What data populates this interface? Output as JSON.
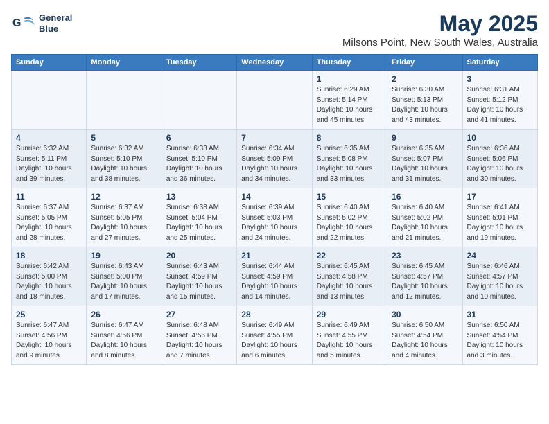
{
  "logo": {
    "line1": "General",
    "line2": "Blue"
  },
  "title": "May 2025",
  "subtitle": "Milsons Point, New South Wales, Australia",
  "days_of_week": [
    "Sunday",
    "Monday",
    "Tuesday",
    "Wednesday",
    "Thursday",
    "Friday",
    "Saturday"
  ],
  "weeks": [
    [
      {
        "num": "",
        "info": ""
      },
      {
        "num": "",
        "info": ""
      },
      {
        "num": "",
        "info": ""
      },
      {
        "num": "",
        "info": ""
      },
      {
        "num": "1",
        "info": "Sunrise: 6:29 AM\nSunset: 5:14 PM\nDaylight: 10 hours\nand 45 minutes."
      },
      {
        "num": "2",
        "info": "Sunrise: 6:30 AM\nSunset: 5:13 PM\nDaylight: 10 hours\nand 43 minutes."
      },
      {
        "num": "3",
        "info": "Sunrise: 6:31 AM\nSunset: 5:12 PM\nDaylight: 10 hours\nand 41 minutes."
      }
    ],
    [
      {
        "num": "4",
        "info": "Sunrise: 6:32 AM\nSunset: 5:11 PM\nDaylight: 10 hours\nand 39 minutes."
      },
      {
        "num": "5",
        "info": "Sunrise: 6:32 AM\nSunset: 5:10 PM\nDaylight: 10 hours\nand 38 minutes."
      },
      {
        "num": "6",
        "info": "Sunrise: 6:33 AM\nSunset: 5:10 PM\nDaylight: 10 hours\nand 36 minutes."
      },
      {
        "num": "7",
        "info": "Sunrise: 6:34 AM\nSunset: 5:09 PM\nDaylight: 10 hours\nand 34 minutes."
      },
      {
        "num": "8",
        "info": "Sunrise: 6:35 AM\nSunset: 5:08 PM\nDaylight: 10 hours\nand 33 minutes."
      },
      {
        "num": "9",
        "info": "Sunrise: 6:35 AM\nSunset: 5:07 PM\nDaylight: 10 hours\nand 31 minutes."
      },
      {
        "num": "10",
        "info": "Sunrise: 6:36 AM\nSunset: 5:06 PM\nDaylight: 10 hours\nand 30 minutes."
      }
    ],
    [
      {
        "num": "11",
        "info": "Sunrise: 6:37 AM\nSunset: 5:05 PM\nDaylight: 10 hours\nand 28 minutes."
      },
      {
        "num": "12",
        "info": "Sunrise: 6:37 AM\nSunset: 5:05 PM\nDaylight: 10 hours\nand 27 minutes."
      },
      {
        "num": "13",
        "info": "Sunrise: 6:38 AM\nSunset: 5:04 PM\nDaylight: 10 hours\nand 25 minutes."
      },
      {
        "num": "14",
        "info": "Sunrise: 6:39 AM\nSunset: 5:03 PM\nDaylight: 10 hours\nand 24 minutes."
      },
      {
        "num": "15",
        "info": "Sunrise: 6:40 AM\nSunset: 5:02 PM\nDaylight: 10 hours\nand 22 minutes."
      },
      {
        "num": "16",
        "info": "Sunrise: 6:40 AM\nSunset: 5:02 PM\nDaylight: 10 hours\nand 21 minutes."
      },
      {
        "num": "17",
        "info": "Sunrise: 6:41 AM\nSunset: 5:01 PM\nDaylight: 10 hours\nand 19 minutes."
      }
    ],
    [
      {
        "num": "18",
        "info": "Sunrise: 6:42 AM\nSunset: 5:00 PM\nDaylight: 10 hours\nand 18 minutes."
      },
      {
        "num": "19",
        "info": "Sunrise: 6:43 AM\nSunset: 5:00 PM\nDaylight: 10 hours\nand 17 minutes."
      },
      {
        "num": "20",
        "info": "Sunrise: 6:43 AM\nSunset: 4:59 PM\nDaylight: 10 hours\nand 15 minutes."
      },
      {
        "num": "21",
        "info": "Sunrise: 6:44 AM\nSunset: 4:59 PM\nDaylight: 10 hours\nand 14 minutes."
      },
      {
        "num": "22",
        "info": "Sunrise: 6:45 AM\nSunset: 4:58 PM\nDaylight: 10 hours\nand 13 minutes."
      },
      {
        "num": "23",
        "info": "Sunrise: 6:45 AM\nSunset: 4:57 PM\nDaylight: 10 hours\nand 12 minutes."
      },
      {
        "num": "24",
        "info": "Sunrise: 6:46 AM\nSunset: 4:57 PM\nDaylight: 10 hours\nand 10 minutes."
      }
    ],
    [
      {
        "num": "25",
        "info": "Sunrise: 6:47 AM\nSunset: 4:56 PM\nDaylight: 10 hours\nand 9 minutes."
      },
      {
        "num": "26",
        "info": "Sunrise: 6:47 AM\nSunset: 4:56 PM\nDaylight: 10 hours\nand 8 minutes."
      },
      {
        "num": "27",
        "info": "Sunrise: 6:48 AM\nSunset: 4:56 PM\nDaylight: 10 hours\nand 7 minutes."
      },
      {
        "num": "28",
        "info": "Sunrise: 6:49 AM\nSunset: 4:55 PM\nDaylight: 10 hours\nand 6 minutes."
      },
      {
        "num": "29",
        "info": "Sunrise: 6:49 AM\nSunset: 4:55 PM\nDaylight: 10 hours\nand 5 minutes."
      },
      {
        "num": "30",
        "info": "Sunrise: 6:50 AM\nSunset: 4:54 PM\nDaylight: 10 hours\nand 4 minutes."
      },
      {
        "num": "31",
        "info": "Sunrise: 6:50 AM\nSunset: 4:54 PM\nDaylight: 10 hours\nand 3 minutes."
      }
    ]
  ]
}
